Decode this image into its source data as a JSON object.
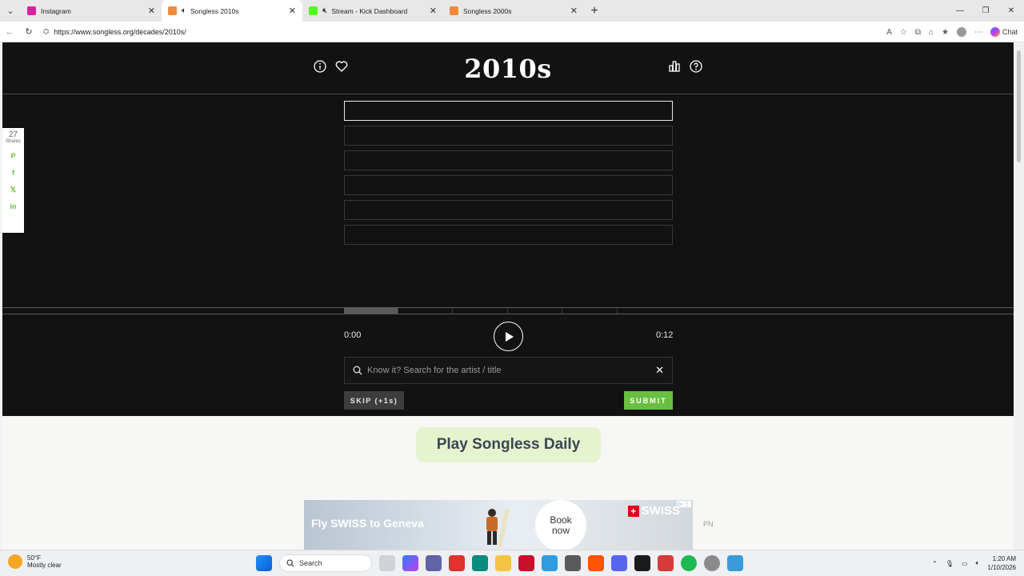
{
  "browser": {
    "tabs": [
      {
        "title": "Instagram",
        "color": "#d6249f"
      },
      {
        "title": "Songless 2010s",
        "color": "#f08a3c",
        "active": true
      },
      {
        "title": "Stream - Kick Dashboard",
        "color": "#53fc18"
      },
      {
        "title": "Songless 2000s",
        "color": "#f08a3c"
      }
    ],
    "url": "https://www.songless.org/decades/2010s/",
    "chat_label": "Chat"
  },
  "share": {
    "count": "27",
    "label": "Shares",
    "networks": [
      "pinterest-icon",
      "facebook-icon",
      "x-icon",
      "linkedin-icon"
    ]
  },
  "game": {
    "title": "2010s",
    "time_start": "0:00",
    "time_end": "0:12",
    "guess_rows": 6,
    "progress_segments": 6,
    "progress_played": 1,
    "search_placeholder": "Know it? Search for the artist / title",
    "skip_label": "SKIP (+1s)",
    "submit_label": "SUBMIT"
  },
  "daily": {
    "label": "Play Songless Daily"
  },
  "ad": {
    "headline": "Fly SWISS to Geneva",
    "book_line1": "Book",
    "book_line2": "now",
    "brand": "SWISS",
    "pn": "PN"
  },
  "taskbar": {
    "temp": "50°F",
    "condition": "Mostly clear",
    "search": "Search",
    "time": "1:20 AM",
    "date": "1/10/2026"
  }
}
